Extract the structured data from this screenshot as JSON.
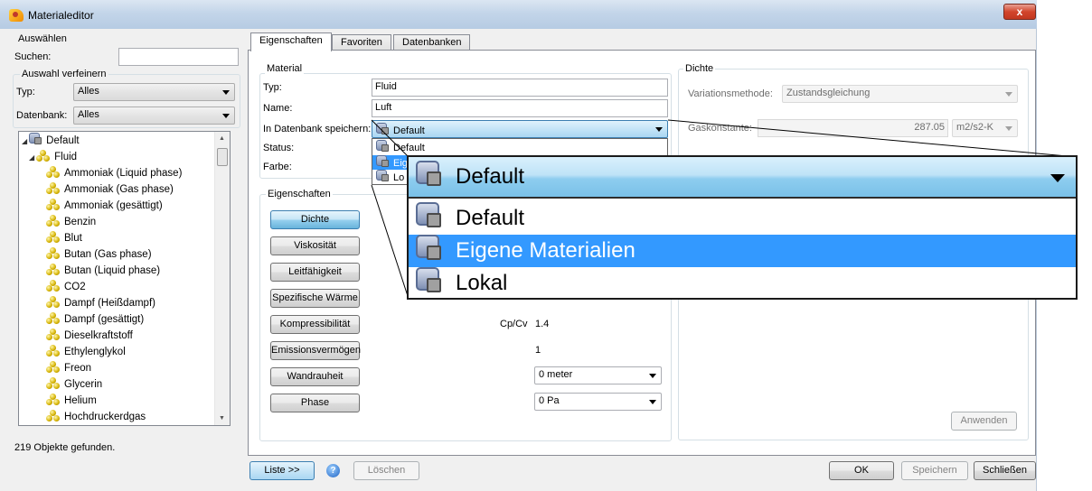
{
  "window": {
    "title": "Materialeditor",
    "close_glyph": "x"
  },
  "left": {
    "select_group": "Auswählen",
    "search_label": "Suchen:",
    "search_value": "",
    "refine_group": "Auswahl verfeinern",
    "type_label": "Typ:",
    "type_value": "Alles",
    "db_label": "Datenbank:",
    "db_value": "Alles",
    "tree": {
      "root": "Default",
      "fluid": "Fluid",
      "items": [
        "Ammoniak  (Liquid phase)",
        "Ammoniak (Gas phase)",
        "Ammoniak (gesättigt)",
        "Benzin",
        "Blut",
        "Butan (Gas phase)",
        "Butan (Liquid phase)",
        "CO2",
        "Dampf (Heißdampf)",
        "Dampf (gesättigt)",
        "Dieselkraftstoff",
        "Ethylenglykol",
        "Freon",
        "Glycerin",
        "Helium",
        "Hochdruckerdgas"
      ]
    },
    "status": "219 Objekte gefunden."
  },
  "tabs": [
    "Eigenschaften",
    "Favoriten",
    "Datenbanken"
  ],
  "material": {
    "group": "Material",
    "type_label": "Typ:",
    "type_value": "Fluid",
    "name_label": "Name:",
    "name_value": "Luft",
    "db_label": "In Datenbank speichern:",
    "db_value": "Default",
    "status_label": "Status:",
    "color_label": "Farbe:",
    "dropdown_options": [
      "Default",
      "Eigene Materialien",
      "Lokal"
    ],
    "dropdown_visible": [
      "Default",
      "Eige",
      "Lo"
    ]
  },
  "properties": {
    "group": "Eigenschaften",
    "buttons": [
      "Dichte",
      "Viskosität",
      "Leitfähigkeit",
      "Spezifische Wärme",
      "Kompressibilität",
      "Emissionsvermögen",
      "Wandrauheit",
      "Phase"
    ],
    "cp_label": "Cp/Cv",
    "cp_value": "1.4",
    "emission_value": "1",
    "roughness_value": "0 meter",
    "phase_value": "0 Pa"
  },
  "density": {
    "group": "Dichte",
    "method_label": "Variationsmethode:",
    "method_value": "Zustandsgleichung",
    "gas_label": "Gaskonstante:",
    "gas_value": "287.05",
    "gas_unit": "m2/s2-K",
    "apply": "Anwenden"
  },
  "footer": {
    "list": "Liste >>",
    "help": "?",
    "delete": "Löschen",
    "ok": "OK",
    "save": "Speichern",
    "close": "Schließen"
  },
  "colors": {
    "accent": "#3399ff",
    "titlebar": "#c3d5e9",
    "close": "#d2452c"
  },
  "icons": [
    "app-icon",
    "database-lock-icon",
    "molecule-icon",
    "chevron-down-icon",
    "help-icon",
    "close-icon"
  ]
}
